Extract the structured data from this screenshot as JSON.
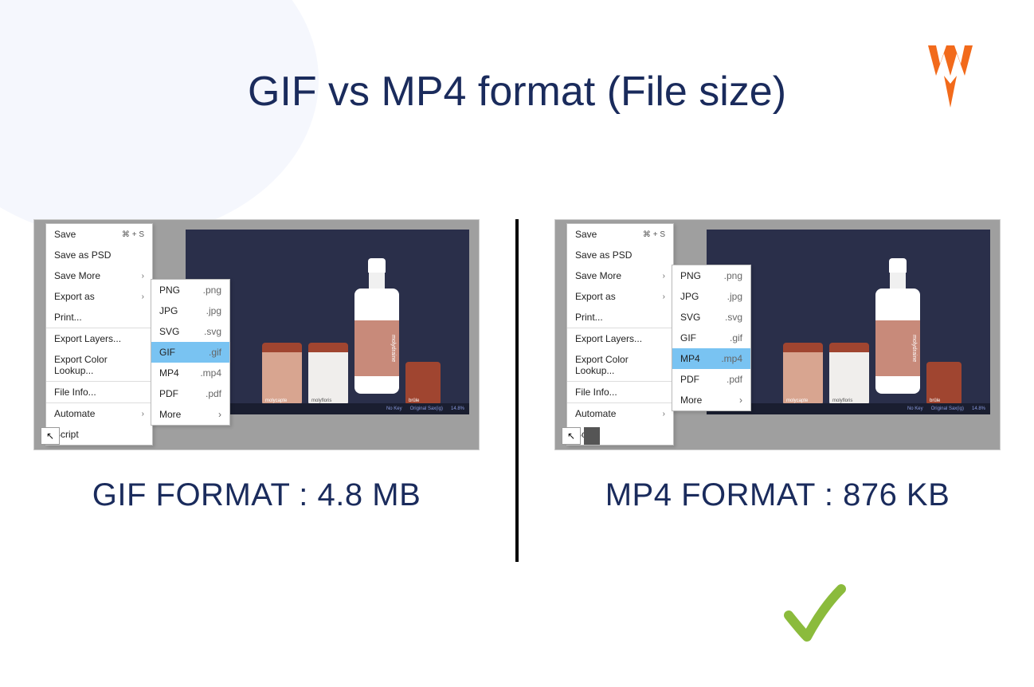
{
  "title": "GIF vs MP4 format (File size)",
  "left": {
    "caption": "GIF FORMAT : 4.8 MB",
    "menu": {
      "save": "Save",
      "save_shortcut": "⌘ + S",
      "save_psd": "Save as PSD",
      "save_more": "Save More",
      "export_as": "Export as",
      "print": "Print...",
      "export_layers": "Export Layers...",
      "export_lookup": "Export Color Lookup...",
      "file_info": "File Info...",
      "automate": "Automate",
      "script": "Script"
    },
    "submenu": [
      {
        "name": "PNG",
        "ext": ".png"
      },
      {
        "name": "JPG",
        "ext": ".jpg"
      },
      {
        "name": "SVG",
        "ext": ".svg"
      },
      {
        "name": "GIF",
        "ext": ".gif",
        "selected": true
      },
      {
        "name": "MP4",
        "ext": ".mp4"
      },
      {
        "name": "PDF",
        "ext": ".pdf"
      },
      {
        "name": "More",
        "ext": "›"
      }
    ]
  },
  "right": {
    "caption": "MP4 FORMAT : 876 KB",
    "menu": {
      "save": "Save",
      "save_shortcut": "⌘ + S",
      "save_psd": "Save as PSD",
      "save_more": "Save More",
      "export_as": "Export as",
      "print": "Print...",
      "export_layers": "Export Layers...",
      "export_lookup": "Export Color Lookup...",
      "file_info": "File Info...",
      "automate": "Automate",
      "script": "Script"
    },
    "submenu": [
      {
        "name": "PNG",
        "ext": ".png"
      },
      {
        "name": "JPG",
        "ext": ".jpg"
      },
      {
        "name": "SVG",
        "ext": ".svg"
      },
      {
        "name": "GIF",
        "ext": ".gif"
      },
      {
        "name": "MP4",
        "ext": ".mp4",
        "selected": true
      },
      {
        "name": "PDF",
        "ext": ".pdf"
      },
      {
        "name": "More",
        "ext": "›"
      }
    ]
  },
  "product_labels": {
    "bottle": "molydraine",
    "jar1": "molycapte",
    "jar2": "molyfloris",
    "jar3": "brûle"
  },
  "canvas_footer": {
    "l1": "No Key",
    "l2": "Original Sax(ig)",
    "l3": "14.8%"
  }
}
